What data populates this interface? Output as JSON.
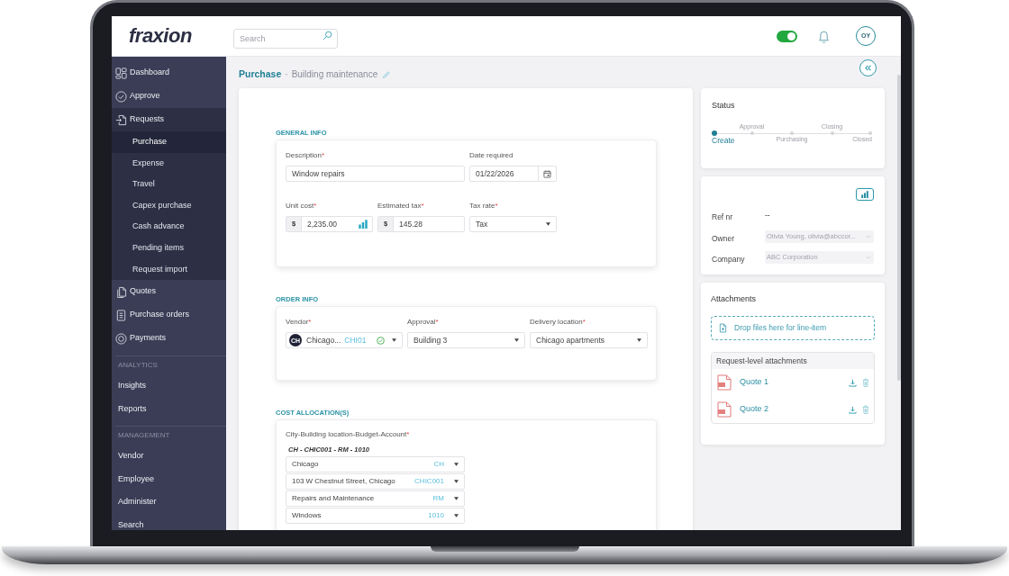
{
  "header": {
    "logo": "fraxion",
    "search": {
      "placeholder": "Search"
    },
    "toggle": {
      "on": true
    },
    "avatar": "OY"
  },
  "sidebar": {
    "groups": [
      {
        "items": [
          {
            "label": "Dashboard",
            "selected": false,
            "expanded": false
          },
          {
            "label": "Approve",
            "selected": false,
            "expanded": false
          },
          {
            "label": "Requests",
            "selected": false,
            "expanded": true,
            "children": [
              {
                "label": "Purchase",
                "selected": true
              },
              {
                "label": "Expense",
                "selected": false
              },
              {
                "label": "Travel",
                "selected": false
              },
              {
                "label": "Capex purchase",
                "selected": false
              },
              {
                "label": "Cash advance",
                "selected": false
              },
              {
                "label": "Pending items",
                "selected": false
              },
              {
                "label": "Request import",
                "selected": false
              }
            ]
          },
          {
            "label": "Quotes",
            "selected": false,
            "expanded": false
          },
          {
            "label": "Purchase orders",
            "selected": false,
            "expanded": false
          },
          {
            "label": "Payments",
            "selected": false,
            "expanded": false
          }
        ]
      },
      {
        "heading": "ANALYTICS",
        "items": [
          {
            "label": "Insights",
            "selected": false
          },
          {
            "label": "Reports",
            "selected": false
          }
        ]
      },
      {
        "heading": "MANAGEMENT",
        "items": [
          {
            "label": "Vendor",
            "selected": false
          },
          {
            "label": "Employee",
            "selected": false
          },
          {
            "label": "Administer",
            "selected": false
          },
          {
            "label": "Search",
            "selected": false
          }
        ]
      }
    ]
  },
  "page": {
    "title": "Purchase",
    "separator": "·",
    "subtitle": "Building maintenance"
  },
  "form": {
    "sections": [
      {
        "kind": "general",
        "heading": "GENERAL INFO",
        "fields": [
          {
            "kind": "text",
            "label": "Description",
            "mark": "*",
            "value": "Window repairs"
          },
          {
            "kind": "date",
            "label": "Date required",
            "value": "01/22/2026"
          },
          {
            "kind": "currency",
            "label": "Unit cost",
            "mark": "*",
            "prefix": "$",
            "value": "2,235.00",
            "analytics": true
          },
          {
            "kind": "currency",
            "label": "Estimated tax",
            "mark": "*",
            "prefix": "$",
            "value": "145.28",
            "analytics": false
          },
          {
            "kind": "select",
            "label": "Tax rate",
            "mark": "*",
            "value": "Tax"
          }
        ]
      },
      {
        "kind": "order",
        "heading": "ORDER INFO",
        "fields": [
          {
            "kind": "vendor",
            "label": "Vendor",
            "mark": "*",
            "avatar": "CH",
            "value": "Chicago...",
            "code": "CHI01",
            "verified": true
          },
          {
            "kind": "select",
            "label": "Approval",
            "mark": "*",
            "value": "Building 3"
          },
          {
            "kind": "select",
            "label": "Delivery location",
            "mark": "*",
            "value": "Chicago apartments"
          }
        ]
      },
      {
        "kind": "allocation",
        "heading": "COST ALLOCATION(S)",
        "label": "City-Building location-Budget-Account",
        "mark": "*",
        "summary": "CH - CHIC001 - RM - 1010",
        "segments": [
          {
            "value": "Chicago",
            "code": "CH"
          },
          {
            "value": "103 W Chestnut Street, Chicago",
            "code": "CHIC001"
          },
          {
            "value": "Repairs and Maintenance",
            "code": "RM"
          },
          {
            "value": "Windows",
            "code": "1010"
          }
        ]
      }
    ]
  },
  "status": {
    "title": "Status",
    "steps": [
      {
        "label": "Create",
        "selected": true
      },
      {
        "label": "Approval",
        "selected": false
      },
      {
        "label": "Purchasing",
        "selected": false
      },
      {
        "label": "Closing",
        "selected": false
      },
      {
        "label": "Closed",
        "selected": false
      }
    ]
  },
  "details": {
    "rows": [
      {
        "kind": "text",
        "label": "Ref nr",
        "value": "--"
      },
      {
        "kind": "select",
        "label": "Owner",
        "value": "Olivia Young, olivia@abccor...",
        "disabled": true
      },
      {
        "kind": "select",
        "label": "Company",
        "value": "ABC Corporation",
        "disabled": true
      }
    ]
  },
  "attachments": {
    "title": "Attachments",
    "dropzone": "Drop files here for line-item",
    "list": {
      "title": "Request-level attachments",
      "files": [
        {
          "name": "Quote 1"
        },
        {
          "name": "Quote 2"
        }
      ]
    }
  }
}
